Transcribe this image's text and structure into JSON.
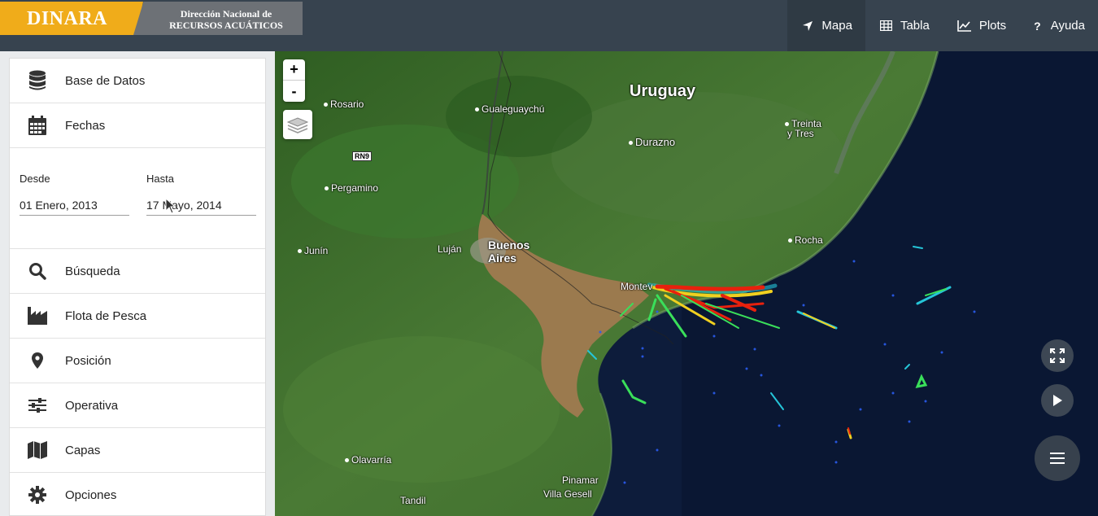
{
  "brand": {
    "name": "DINARA",
    "subtitle_line1": "Dirección Nacional de",
    "subtitle_line2": "RECURSOS ACUÁTICOS"
  },
  "nav": {
    "items": [
      {
        "label": "Mapa",
        "icon": "location-arrow-icon",
        "active": true
      },
      {
        "label": "Tabla",
        "icon": "table-icon"
      },
      {
        "label": "Plots",
        "icon": "line-chart-icon"
      },
      {
        "label": "Ayuda",
        "icon": "question-icon"
      }
    ]
  },
  "sidebar": {
    "items": [
      {
        "label": "Base de Datos",
        "icon": "database-icon"
      },
      {
        "label": "Fechas",
        "icon": "calendar-icon"
      },
      {
        "label": "Búsqueda",
        "icon": "search-icon"
      },
      {
        "label": "Flota de Pesca",
        "icon": "factory-icon"
      },
      {
        "label": "Posición",
        "icon": "map-marker-icon"
      },
      {
        "label": "Operativa",
        "icon": "sliders-icon"
      },
      {
        "label": "Capas",
        "icon": "map-icon"
      },
      {
        "label": "Opciones",
        "icon": "gear-icon"
      }
    ],
    "dates": {
      "from_label": "Desde",
      "from_value": "01 Enero, 2013",
      "to_label": "Hasta",
      "to_value": "17 Mayo, 2014"
    }
  },
  "map": {
    "zoom_in": "+",
    "zoom_out": "-",
    "road_label": "RN9",
    "places": {
      "uruguay": "Uruguay",
      "rosario": "Rosario",
      "gualeguaychu": "Gualeguaychú",
      "durazno": "Durazno",
      "treinta_y_tres_1": "Treinta",
      "treinta_y_tres_2": "y Tres",
      "pergamino": "Pergamino",
      "rocha": "Rocha",
      "lujan": "Luján",
      "buenos_aires_1": "Buenos",
      "buenos_aires_2": "Aires",
      "junin": "Junín",
      "montevideo": "Montev",
      "olavarria": "Olavarría",
      "pinamar": "Pinamar",
      "villa_gesell": "Villa Gesell",
      "tandil": "Tandil"
    },
    "colors": {
      "land": "#3b6a2a",
      "estuary": "#9b7a4e",
      "ocean": "#0c1a38",
      "track_hot": "#e8210d",
      "track_warm": "#f0d020",
      "track_cool": "#25c5d8"
    }
  }
}
